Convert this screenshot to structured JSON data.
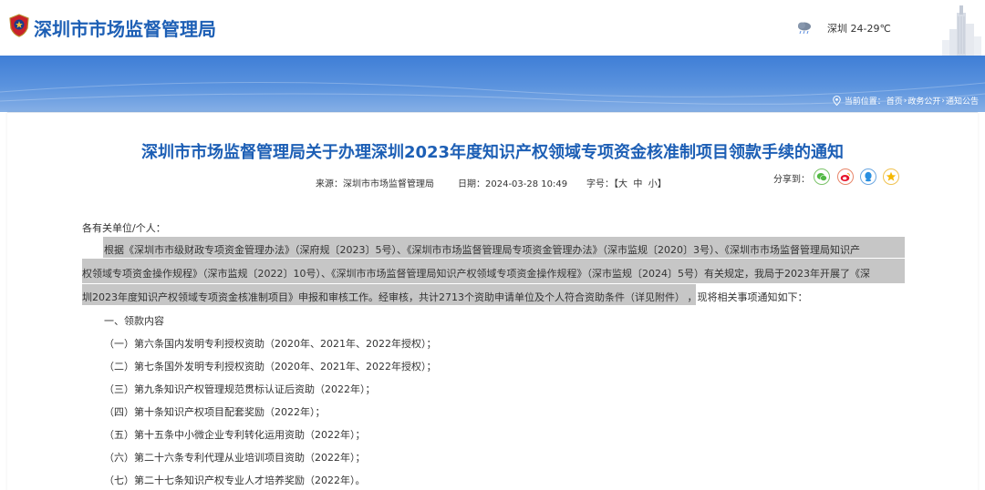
{
  "header": {
    "site_title": "深圳市市场监督管理局",
    "weather": "深圳 24-29℃"
  },
  "breadcrumb": {
    "current_label": "当前位置：",
    "home": "首页",
    "sep1": " › ",
    "section": "政务公开",
    "sep2": " › ",
    "page": "通知公告"
  },
  "article": {
    "title": "深圳市市场监督管理局关于办理深圳2023年度知识产权领域专项资金核准制项目领款手续的通知",
    "source_label": "来源：",
    "source": "深圳市市场监督管理局",
    "date_label": "日期：",
    "date": "2024-03-28 10:49",
    "fontsize_label": "字号：",
    "fontsize_open": "【",
    "fontsize_large": "大",
    "fontsize_medium": "中",
    "fontsize_small": "小",
    "fontsize_close": "】",
    "share_label": "分享到：",
    "salutation": "各有关单位/个人：",
    "para1_line1": "根据《深圳市市级财政专项资金管理办法》（深府规〔2023〕5号）、《深圳市市场监督管理局专项资金管理办法》（深市监规〔2020〕3号）、《深圳市市场监督管理局知识产",
    "para1_line2": "权领域专项资金操作规程》（深市监规〔2022〕10号）、《深圳市市场监督管理局知识产权领域专项资金操作规程》（深市监规〔2024〕5号）有关规定，我局于2023年开展了《深",
    "para1_line3a": "圳2023年度知识产权领域专项资金核准制项目》申报和审核工作。经审核，共计2713个资助申请单位及个人符合资助条件（详见附件）",
    "para1_line3b": "，现将相关事项通知如下：",
    "section1": "一、领款内容",
    "items": [
      "（一）第六条国内发明专利授权资助（2020年、2021年、2022年授权）；",
      "（二）第七条国外发明专利授权资助（2020年、2021年、2022年授权）；",
      "（三）第九条知识产权管理规范贯标认证后资助（2022年）；",
      "（四）第十条知识产权项目配套奖励（2022年）；",
      "（五）第十五条中小微企业专利转化运用资助（2022年）；",
      "（六）第二十六条专利代理从业培训项目资助（2022年）；",
      "（七）第二十七条知识产权专业人才培养奖励（2022年）。"
    ]
  },
  "share_icons": [
    "wechat-icon",
    "weibo-icon",
    "qq-icon",
    "qzone-icon"
  ],
  "colors": {
    "brand_blue": "#1d5fb5",
    "banner_blue": "#4f8ad9",
    "highlight_gray": "#c6c6c6"
  }
}
